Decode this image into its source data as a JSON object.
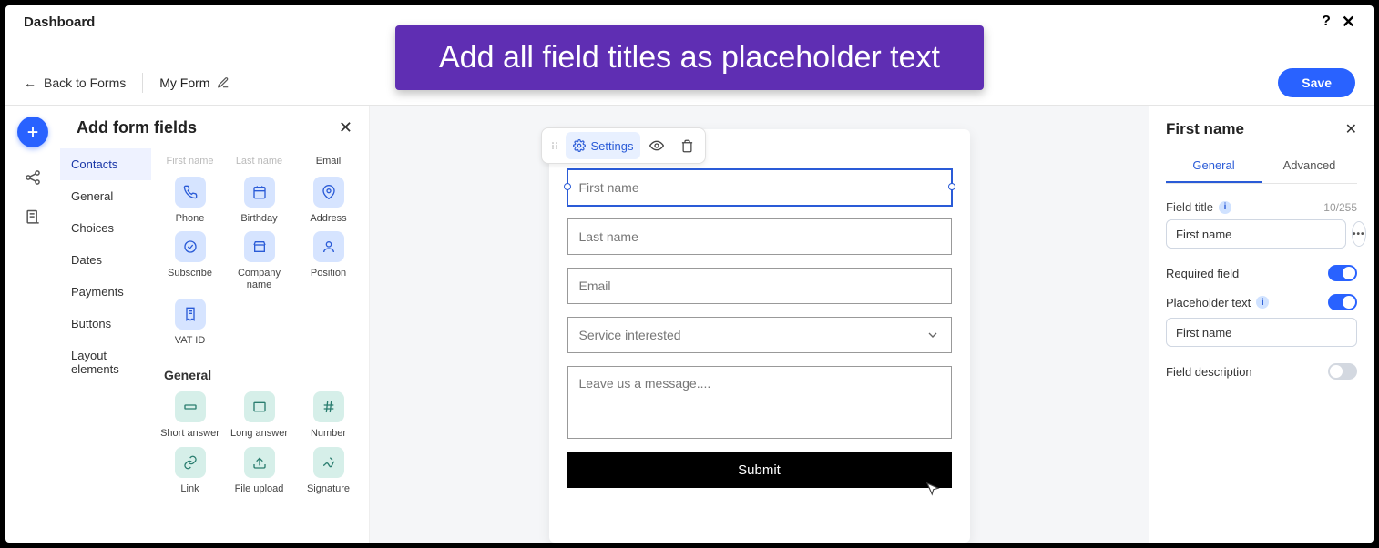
{
  "overlay": {
    "text": "Add all field titles as placeholder text"
  },
  "topbar": {
    "title": "Dashboard"
  },
  "nav": {
    "back": "Back to Forms",
    "form_name": "My Form",
    "save": "Save"
  },
  "panel": {
    "title": "Add form fields",
    "categories": [
      "Contacts",
      "General",
      "Choices",
      "Dates",
      "Payments",
      "Buttons",
      "Layout elements"
    ],
    "contacts_text": [
      "First name",
      "Last name",
      "Email"
    ],
    "contacts_fields": [
      {
        "label": "Phone"
      },
      {
        "label": "Birthday"
      },
      {
        "label": "Address"
      },
      {
        "label": "Subscribe"
      },
      {
        "label": "Company name"
      },
      {
        "label": "Position"
      },
      {
        "label": "VAT ID"
      }
    ],
    "general_head": "General",
    "general_fields": [
      {
        "label": "Short answer"
      },
      {
        "label": "Long answer"
      },
      {
        "label": "Number"
      },
      {
        "label": "Link"
      },
      {
        "label": "File upload"
      },
      {
        "label": "Signature"
      }
    ]
  },
  "toolbar": {
    "settings": "Settings"
  },
  "form": {
    "first_name": "First name",
    "last_name": "Last name",
    "email": "Email",
    "service": "Service interested",
    "message": "Leave us a message....",
    "submit": "Submit"
  },
  "settings": {
    "title": "First name",
    "tabs": {
      "general": "General",
      "advanced": "Advanced"
    },
    "field_title_label": "Field title",
    "field_title_count": "10/255",
    "field_title_value": "First name",
    "required_label": "Required field",
    "required_on": true,
    "placeholder_label": "Placeholder text",
    "placeholder_on": true,
    "placeholder_value": "First name",
    "description_label": "Field description",
    "description_on": false
  }
}
